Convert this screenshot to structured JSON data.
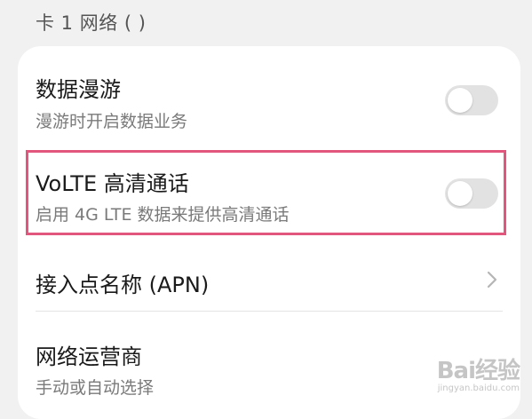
{
  "section_header": "卡 1 网络 (                )",
  "settings": {
    "data_roaming": {
      "title": "数据漫游",
      "subtitle": "漫游时开启数据业务",
      "toggle_on": false
    },
    "volte": {
      "title": "VoLTE 高清通话",
      "subtitle": "启用 4G LTE 数据来提供高清通话",
      "toggle_on": false
    },
    "apn": {
      "title": "接入点名称 (APN)"
    },
    "network_operator": {
      "title": "网络运营商",
      "subtitle": "手动或自动选择"
    }
  },
  "watermark": {
    "brand": "Bai经验",
    "url": "jingyan.baidu.com"
  },
  "colors": {
    "highlight_border": "#e2567e",
    "toggle_off": "#e2e2e2",
    "background": "#f1f1f1"
  }
}
